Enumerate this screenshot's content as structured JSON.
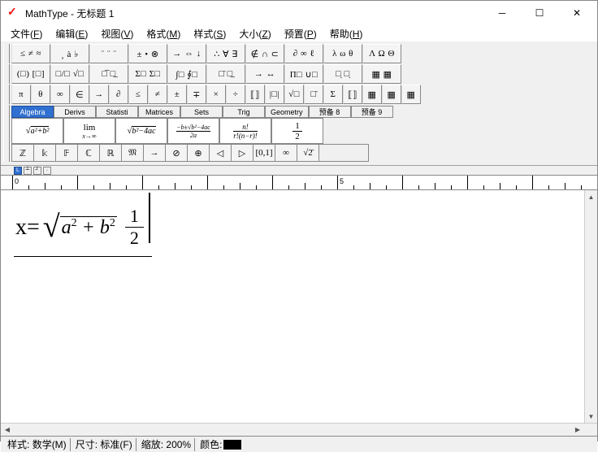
{
  "window": {
    "title": "MathType - 无标题 1"
  },
  "menus": [
    {
      "label": "文件",
      "key": "F"
    },
    {
      "label": "编辑",
      "key": "E"
    },
    {
      "label": "视图",
      "key": "V"
    },
    {
      "label": "格式",
      "key": "M"
    },
    {
      "label": "样式",
      "key": "S"
    },
    {
      "label": "大小",
      "key": "Z"
    },
    {
      "label": "预置",
      "key": "P"
    },
    {
      "label": "帮助",
      "key": "H"
    }
  ],
  "palette_row1": [
    "≤ ≠ ≈",
    "¸ à ♭",
    "¨ ¨ ¨",
    "± • ⊗",
    "→ ⇔ ↓",
    "∴ ∀ ∃",
    "∉ ∩ ⊂",
    "∂ ∞ ℓ",
    "λ ω θ",
    "Λ Ω Θ"
  ],
  "palette_row2": [
    "(□) [□]",
    "□/□ √□",
    "□̅  □̲",
    "Σ□ Σ□",
    "∫□ ∮□",
    "□̄  □̲",
    "→  ↔",
    "Π□ ∪□",
    "□̣  □̣",
    "▦ ▦"
  ],
  "palette_row3": [
    "π",
    "θ",
    "∞",
    "∈",
    "→",
    "∂",
    "≤",
    "≠",
    "±",
    "∓",
    "×",
    "÷",
    "⟦⟧",
    "|□|",
    "√□",
    "□̄",
    "Σ",
    "⟦⟧",
    "▦",
    "▦",
    "▦"
  ],
  "category_tabs": [
    "Algebra",
    "Derivs",
    "Statisti",
    "Matrices",
    "Sets",
    "Trig",
    "Geometry",
    "预备 8",
    "预备 9"
  ],
  "active_tab_index": 0,
  "formula_buttons": [
    "sqrt_a2_b2",
    "lim_xinf",
    "sqrt_b2_4ac",
    "quad_frac",
    "n_fact_frac",
    "half"
  ],
  "bottom_row": [
    "ℤ",
    "𝕜",
    "𝔽",
    "ℂ",
    "ℝ",
    "𝔐",
    "→",
    "⊘",
    "⊕",
    "◁",
    "▷",
    "[0,1]",
    "∞",
    "√2̄"
  ],
  "tab_markers": [
    "L",
    "C",
    "R",
    "D"
  ],
  "ruler_numbers": [
    "0",
    "5"
  ],
  "editor": {
    "x_eq": "x=",
    "rad": "a² + b²",
    "rad_html": "a<sup>2</sup> + b<sup>2</sup>",
    "num": "1",
    "den": "2"
  },
  "status": {
    "style_label": "样式:",
    "style_value": "数学(M)",
    "size_label": "尺寸:",
    "size_value": "标准(F)",
    "zoom_label": "缩放:",
    "zoom_value": "200%",
    "color_label": "颜色:",
    "color_hex": "#000000"
  }
}
